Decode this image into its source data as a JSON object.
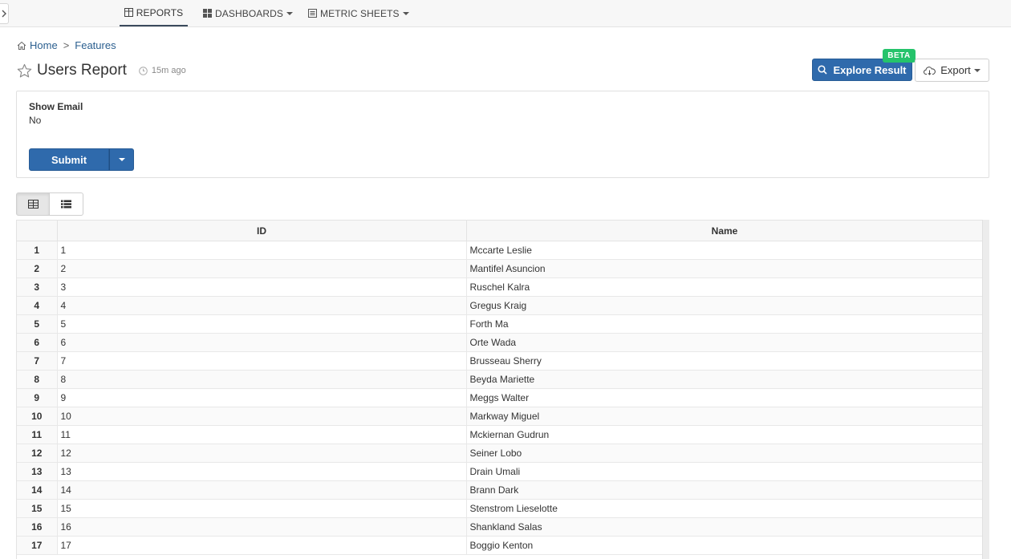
{
  "nav": {
    "tabs": [
      {
        "label": "REPORTS",
        "icon": "table-icon",
        "active": true
      },
      {
        "label": "DASHBOARDS",
        "icon": "dashboard-icon",
        "active": false
      },
      {
        "label": "METRIC SHEETS",
        "icon": "list-icon",
        "active": false
      }
    ]
  },
  "breadcrumb": {
    "home": "Home",
    "separator": ">",
    "current": "Features"
  },
  "header": {
    "title": "Users Report",
    "time_ago": "15m ago",
    "explore_label": "Explore Result",
    "beta_label": "BETA",
    "export_label": "Export"
  },
  "filter": {
    "label": "Show Email",
    "value": "No",
    "submit_label": "Submit"
  },
  "table": {
    "columns": [
      "ID",
      "Name"
    ],
    "rows": [
      {
        "n": "1",
        "id": "1",
        "name": "Mccarte Leslie"
      },
      {
        "n": "2",
        "id": "2",
        "name": "Mantifel Asuncion"
      },
      {
        "n": "3",
        "id": "3",
        "name": "Ruschel Kalra"
      },
      {
        "n": "4",
        "id": "4",
        "name": "Gregus Kraig"
      },
      {
        "n": "5",
        "id": "5",
        "name": "Forth Ma"
      },
      {
        "n": "6",
        "id": "6",
        "name": "Orte Wada"
      },
      {
        "n": "7",
        "id": "7",
        "name": "Brusseau Sherry"
      },
      {
        "n": "8",
        "id": "8",
        "name": "Beyda Mariette"
      },
      {
        "n": "9",
        "id": "9",
        "name": "Meggs Walter"
      },
      {
        "n": "10",
        "id": "10",
        "name": "Markway Miguel"
      },
      {
        "n": "11",
        "id": "11",
        "name": "Mckiernan Gudrun"
      },
      {
        "n": "12",
        "id": "12",
        "name": "Seiner Lobo"
      },
      {
        "n": "13",
        "id": "13",
        "name": "Drain Umali"
      },
      {
        "n": "14",
        "id": "14",
        "name": "Brann Dark"
      },
      {
        "n": "15",
        "id": "15",
        "name": "Stenstrom Lieselotte"
      },
      {
        "n": "16",
        "id": "16",
        "name": "Shankland Salas"
      },
      {
        "n": "17",
        "id": "17",
        "name": "Boggio Kenton"
      }
    ]
  },
  "colors": {
    "primary": "#2f6aac",
    "beta": "#25c36b",
    "link": "#2b5f8f"
  }
}
